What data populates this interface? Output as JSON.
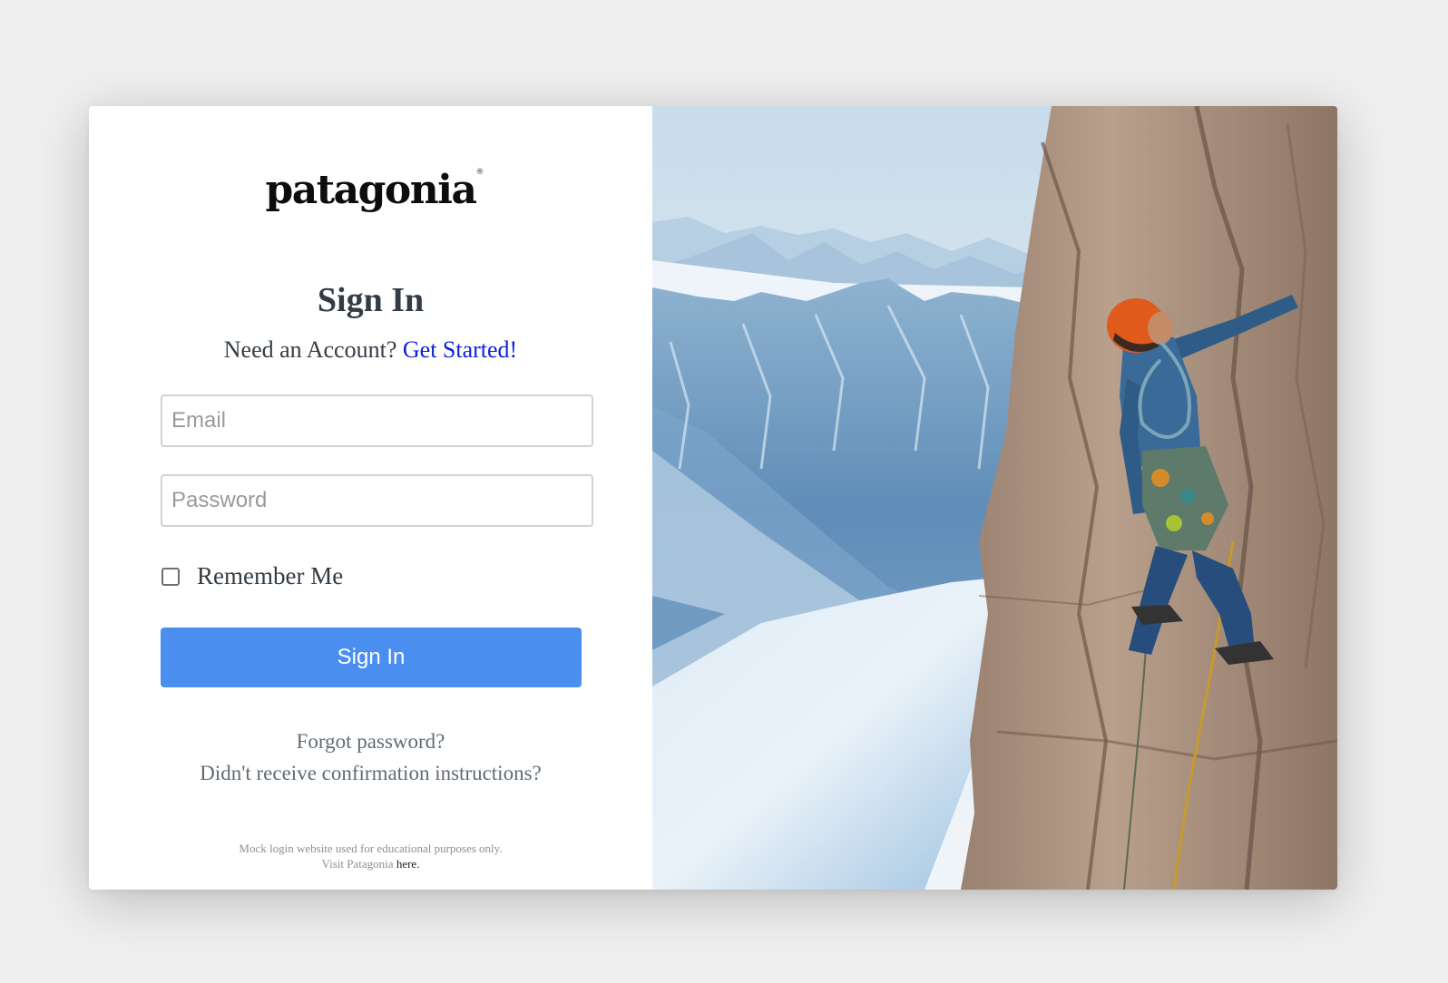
{
  "logo": {
    "text": "patagonia",
    "registered": "®"
  },
  "signin": {
    "title": "Sign In",
    "prompt": "Need an Account?",
    "get_started": "Get Started!",
    "email_placeholder": "Email",
    "password_placeholder": "Password",
    "remember_label": "Remember Me",
    "button_label": "Sign In",
    "forgot": "Forgot password?",
    "confirmation": "Didn't receive confirmation instructions?"
  },
  "footer": {
    "line1": "Mock login website used for educational purposes only.",
    "line2_prefix": "Visit Patagonia",
    "here": "here",
    "period": "."
  },
  "colors": {
    "accent_button": "#4a8ff0",
    "link": "#1020d8",
    "page_bg": "#efefef"
  },
  "hero_image": {
    "icon": "rock-climber-photo"
  }
}
